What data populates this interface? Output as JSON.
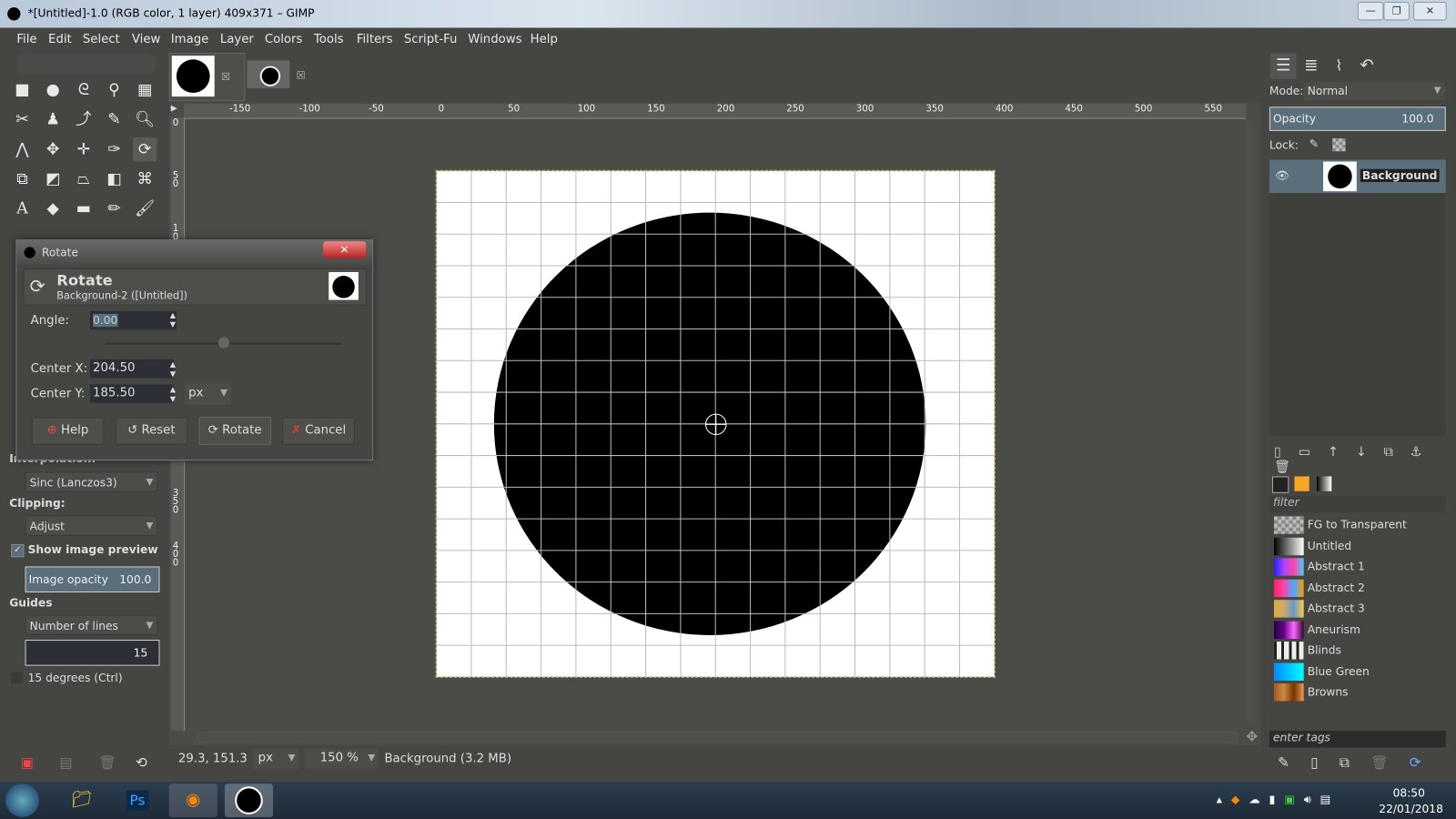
{
  "window": {
    "title": "*[Untitled]-1.0 (RGB color, 1 layer) 409x371 – GIMP",
    "minimize": "—",
    "maximize": "❐",
    "close": "✕"
  },
  "menu": [
    "File",
    "Edit",
    "Select",
    "View",
    "Image",
    "Layer",
    "Colors",
    "Tools",
    "Filters",
    "Script-Fu",
    "Windows",
    "Help"
  ],
  "tool_options": {
    "interpolation_label": "Interpolation:",
    "interpolation_value": "Sinc (Lanczos3)",
    "clipping_label": "Clipping:",
    "clipping_value": "Adjust",
    "show_preview_label": "Show image preview",
    "show_preview_checked": true,
    "image_opacity_label": "Image opacity",
    "image_opacity_value": "100.0",
    "guides_label": "Guides",
    "guides_value": "Number of lines",
    "lines_value": "15",
    "degrees_label": "15 degrees  (Ctrl)"
  },
  "rulers": {
    "h": [
      "-150",
      "-100",
      "-50",
      "0",
      "50",
      "100",
      "150",
      "200",
      "250",
      "300",
      "350",
      "400",
      "450",
      "500",
      "550"
    ],
    "v": [
      "0",
      "50",
      "100",
      "150",
      "200",
      "250",
      "300",
      "350",
      "400"
    ]
  },
  "status": {
    "coords": "29.3, 151.3",
    "unit": "px",
    "zoom": "150 %",
    "info": "Background (3.2 MB)"
  },
  "dialog": {
    "window_title": "Rotate",
    "heading": "Rotate",
    "subheading": "Background-2 ([Untitled])",
    "angle_label": "Angle:",
    "angle_value": "0.00",
    "angle_slider_fraction": 0.5,
    "center_x_label": "Center X:",
    "center_x_value": "204.50",
    "center_y_label": "Center Y:",
    "center_y_value": "185.50",
    "unit": "px",
    "buttons": {
      "help": "Help",
      "reset": "Reset",
      "rotate": "Rotate",
      "cancel": "Cancel"
    },
    "close": "✕"
  },
  "layers": {
    "mode_label": "Mode:",
    "mode_value": "Normal",
    "opacity_label": "Opacity",
    "opacity_value": "100.0",
    "lock_label": "Lock:",
    "layer_name": "Background"
  },
  "gradients": {
    "filter_placeholder": "filter",
    "tags_placeholder": "enter tags",
    "items": [
      {
        "name": "FG to Transparent",
        "css": "repeating-conic-gradient(#888 0 25%,#bbb 0 50%) 0 0/8px 8px"
      },
      {
        "name": "Untitled",
        "css": "linear-gradient(90deg,#000,#fff)"
      },
      {
        "name": "Abstract 1",
        "css": "linear-gradient(90deg,#22f,#a4f,#f4a,#4cf)"
      },
      {
        "name": "Abstract 2",
        "css": "linear-gradient(90deg,#f26,#f4a,#4af,#f90)"
      },
      {
        "name": "Abstract 3",
        "css": "linear-gradient(90deg,#da4,#ca6,#69c,#fc4)"
      },
      {
        "name": "Aneurism",
        "css": "linear-gradient(90deg,#204,#608,#f6f,#303)"
      },
      {
        "name": "Blinds",
        "css": "repeating-linear-gradient(90deg,#222 0 3px,#eee 3px 8px)"
      },
      {
        "name": "Blue Green",
        "css": "linear-gradient(90deg,#08f,#0ff)"
      },
      {
        "name": "Browns",
        "css": "linear-gradient(90deg,#a52,#c84,#730,#e95)"
      }
    ]
  },
  "taskbar": {
    "time": "08:50",
    "date": "22/01/2018",
    "ps_label": "Ps"
  }
}
